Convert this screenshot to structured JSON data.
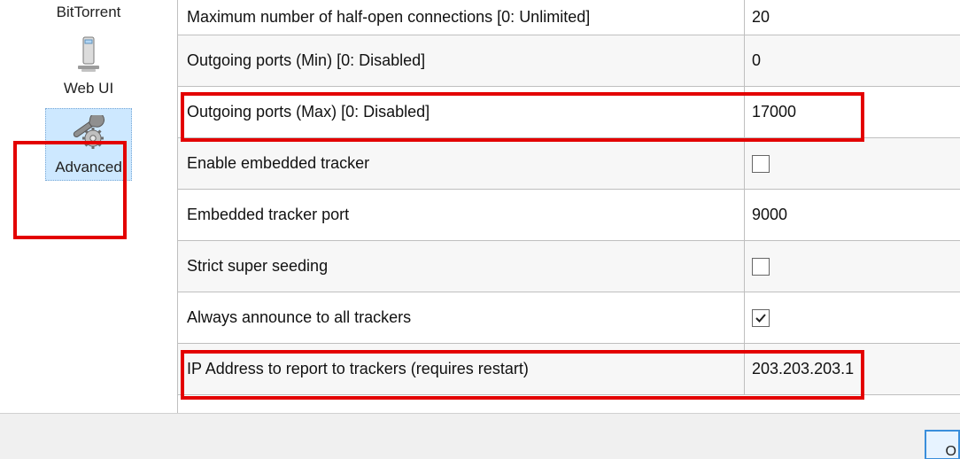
{
  "sidebar": {
    "items": [
      {
        "label": "BitTorrent",
        "icon": "bittorrent-icon"
      },
      {
        "label": "Web UI",
        "icon": "server-icon"
      },
      {
        "label": "Advanced",
        "icon": "wrench-gear-icon"
      }
    ]
  },
  "settings": {
    "rows": [
      {
        "label": "Maximum number of half-open connections [0: Unlimited]",
        "value": "20",
        "type": "text"
      },
      {
        "label": "Outgoing ports (Min) [0: Disabled]",
        "value": "0",
        "type": "text"
      },
      {
        "label": "Outgoing ports (Max) [0: Disabled]",
        "value": "17000",
        "type": "text"
      },
      {
        "label": "Enable embedded tracker",
        "value": false,
        "type": "bool"
      },
      {
        "label": "Embedded tracker port",
        "value": "9000",
        "type": "text"
      },
      {
        "label": "Strict super seeding",
        "value": false,
        "type": "bool"
      },
      {
        "label": "Always announce to all trackers",
        "value": true,
        "type": "bool"
      },
      {
        "label": "IP Address to report to trackers (requires restart)",
        "value": "203.203.203.1",
        "type": "text"
      }
    ]
  },
  "button_ok_fragment": "O"
}
